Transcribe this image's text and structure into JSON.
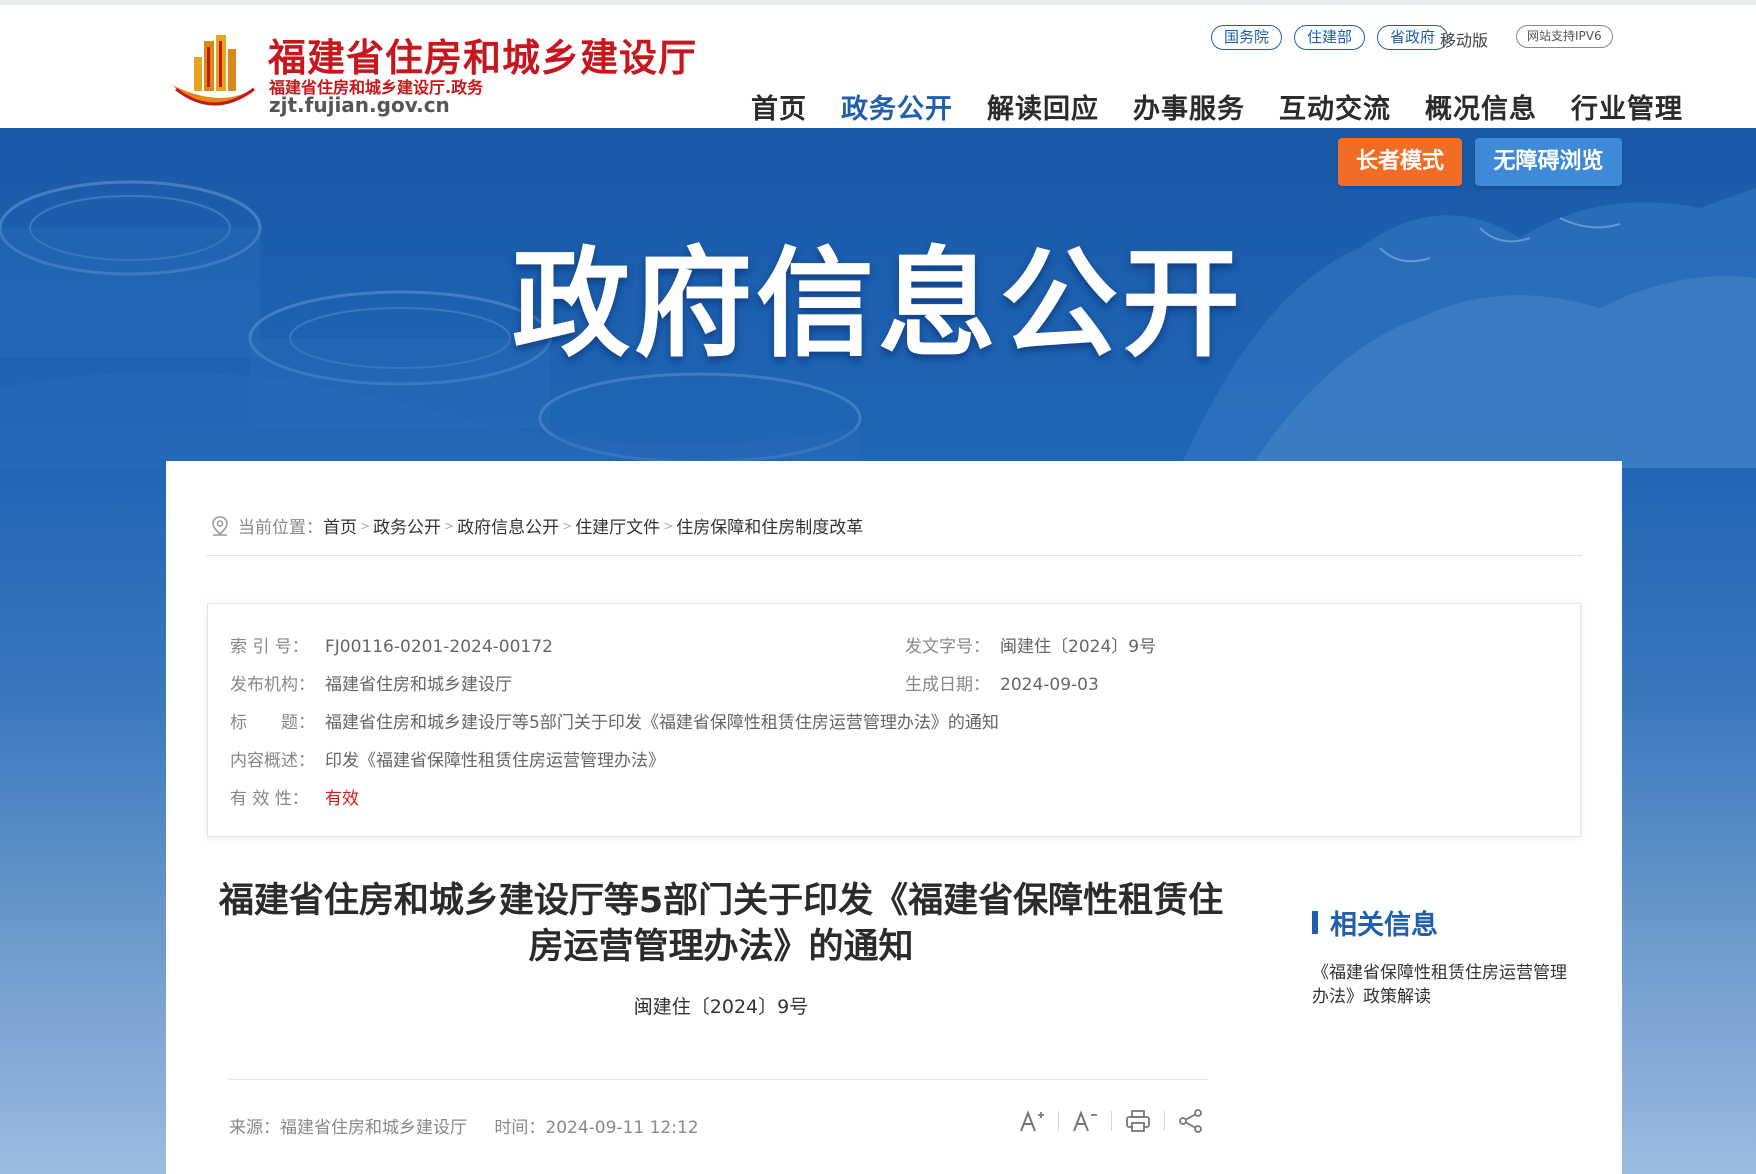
{
  "header": {
    "logo_title": "福建省住房和城乡建设厅",
    "logo_subtitle": "福建省住房和城乡建设厅.政务",
    "logo_domain": "zjt.fujian.gov.cn",
    "top_links": [
      "国务院",
      "住建部",
      "省政府"
    ],
    "mobile_label": "移动版",
    "ipv6_label": "网站支持IPV6",
    "nav": [
      "首页",
      "政务公开",
      "解读回应",
      "办事服务",
      "互动交流",
      "概况信息",
      "行业管理"
    ],
    "active_nav": "政务公开"
  },
  "banner": {
    "elder_mode": "长者模式",
    "accessible": "无障碍浏览",
    "title": "政府信息公开"
  },
  "breadcrumb": {
    "label": "当前位置：",
    "items": [
      "首页",
      "政务公开",
      "政府信息公开",
      "住建厅文件",
      "住房保障和住房制度改革"
    ]
  },
  "meta": {
    "index_label": "索 引 号：",
    "index_value": "FJ00116-0201-2024-00172",
    "doc_no_label": "发文字号：",
    "doc_no_value": "闽建住〔2024〕9号",
    "org_label": "发布机构：",
    "org_value": "福建省住房和城乡建设厅",
    "date_label": "生成日期：",
    "date_value": "2024-09-03",
    "title_label": "标　　题：",
    "title_value": "福建省住房和城乡建设厅等5部门关于印发《福建省保障性租赁住房运营管理办法》的通知",
    "summary_label": "内容概述：",
    "summary_value": "印发《福建省保障性租赁住房运营管理办法》",
    "validity_label": "有 效 性：",
    "validity_value": "有效"
  },
  "document": {
    "title_line1": "福建省住房和城乡建设厅等5部门关于印发《福建省保障性租赁住",
    "title_line2": "房运营管理办法》的通知",
    "number": "闽建住〔2024〕9号",
    "source_label": "来源：",
    "source_value": "福建省住房和城乡建设厅",
    "time_label": "时间：",
    "time_value": "2024-09-11 12:12"
  },
  "related": {
    "title": "相关信息",
    "items": [
      "《福建省保障性租赁住房运营管理办法》政策解读"
    ]
  },
  "colors": {
    "brand_red": "#c8161d",
    "brand_blue": "#1f5fad",
    "elder_orange": "#f16d25",
    "access_blue": "#3f8ad8"
  },
  "icons": [
    "location-pin-icon",
    "font-increase-icon",
    "font-decrease-icon",
    "print-icon",
    "share-icon"
  ]
}
